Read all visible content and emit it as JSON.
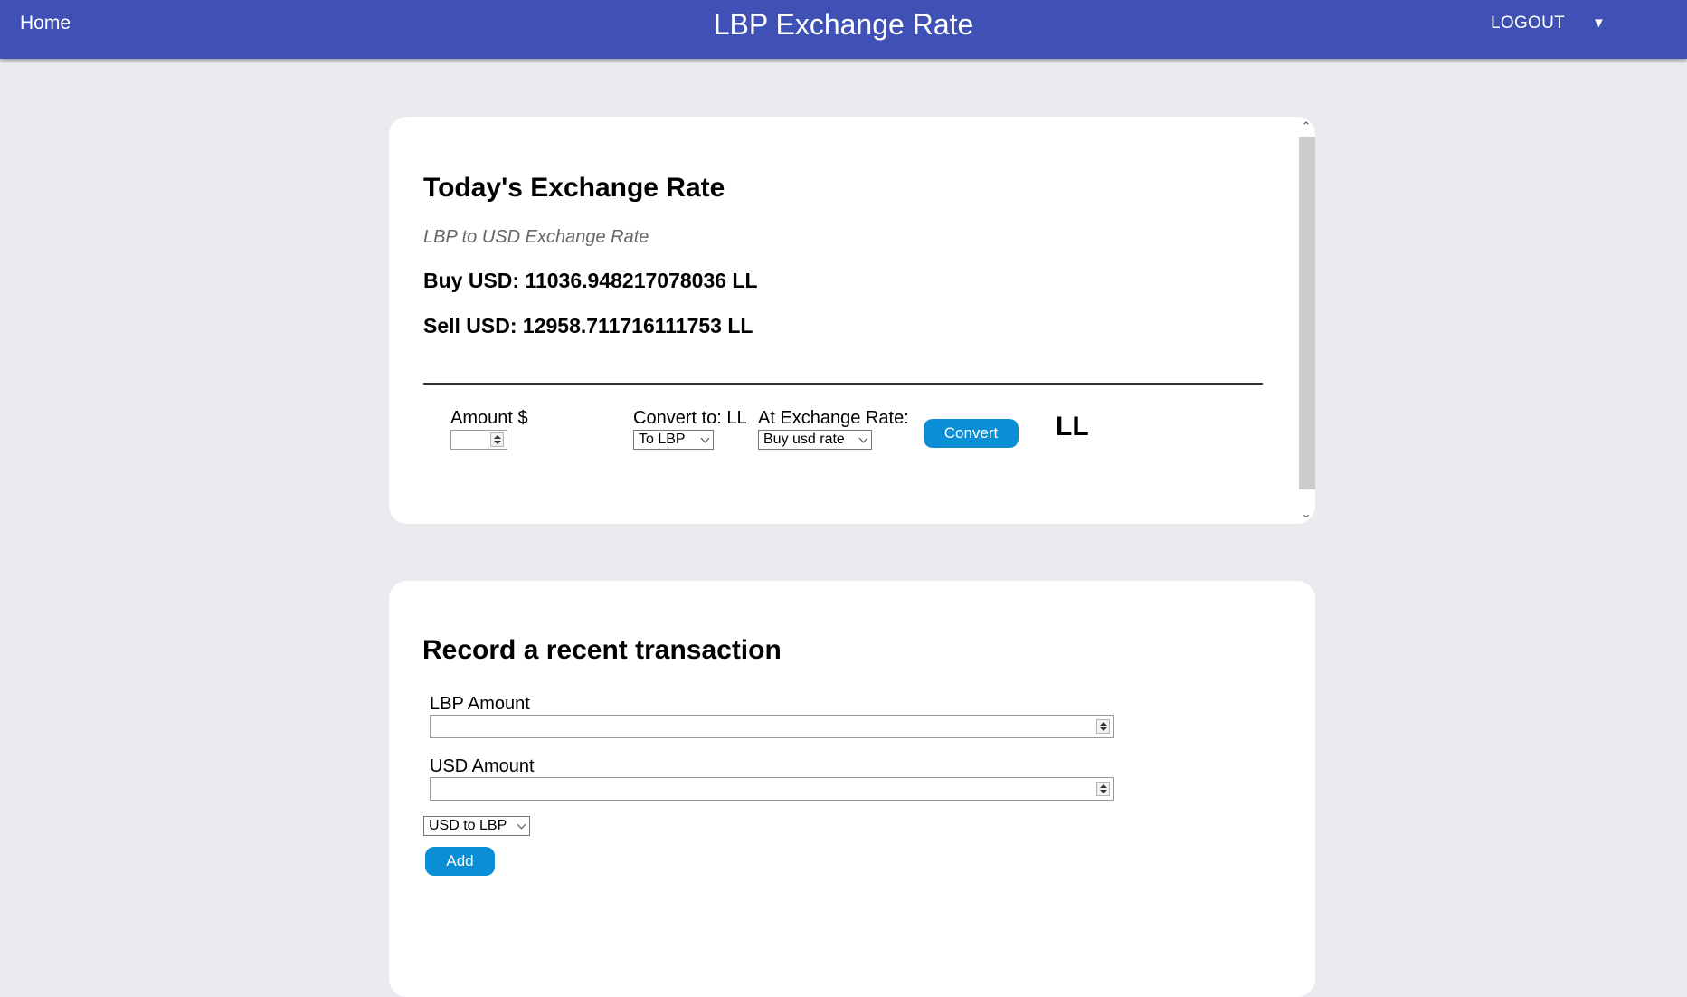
{
  "header": {
    "home_label": "Home",
    "title": "LBP Exchange Rate",
    "logout_label": "LOGOUT",
    "menu_caret": "▼",
    "bar_color": "#3f51b5"
  },
  "rate_card": {
    "title": "Today's Exchange Rate",
    "subtitle": "LBP to USD Exchange Rate",
    "buy_line": "Buy USD: 11036.948217078036 LL",
    "sell_line": "Sell USD: 12958.711716111753 LL",
    "converter": {
      "amount_label": "Amount $",
      "amount_value": "",
      "convert_to_label": "Convert to: LL",
      "convert_to_selected": "To LBP",
      "rate_label": "At Exchange Rate:",
      "rate_selected": "Buy usd rate",
      "convert_button": "Convert",
      "result_unit": "LL"
    }
  },
  "record_card": {
    "title": "Record a recent transaction",
    "lbp_label": "LBP Amount",
    "lbp_value": "",
    "usd_label": "USD Amount",
    "usd_value": "",
    "direction_selected": "USD to LBP",
    "add_button": "Add"
  },
  "colors": {
    "page_background": "#e9ebef",
    "button": "#0a8fd6"
  }
}
